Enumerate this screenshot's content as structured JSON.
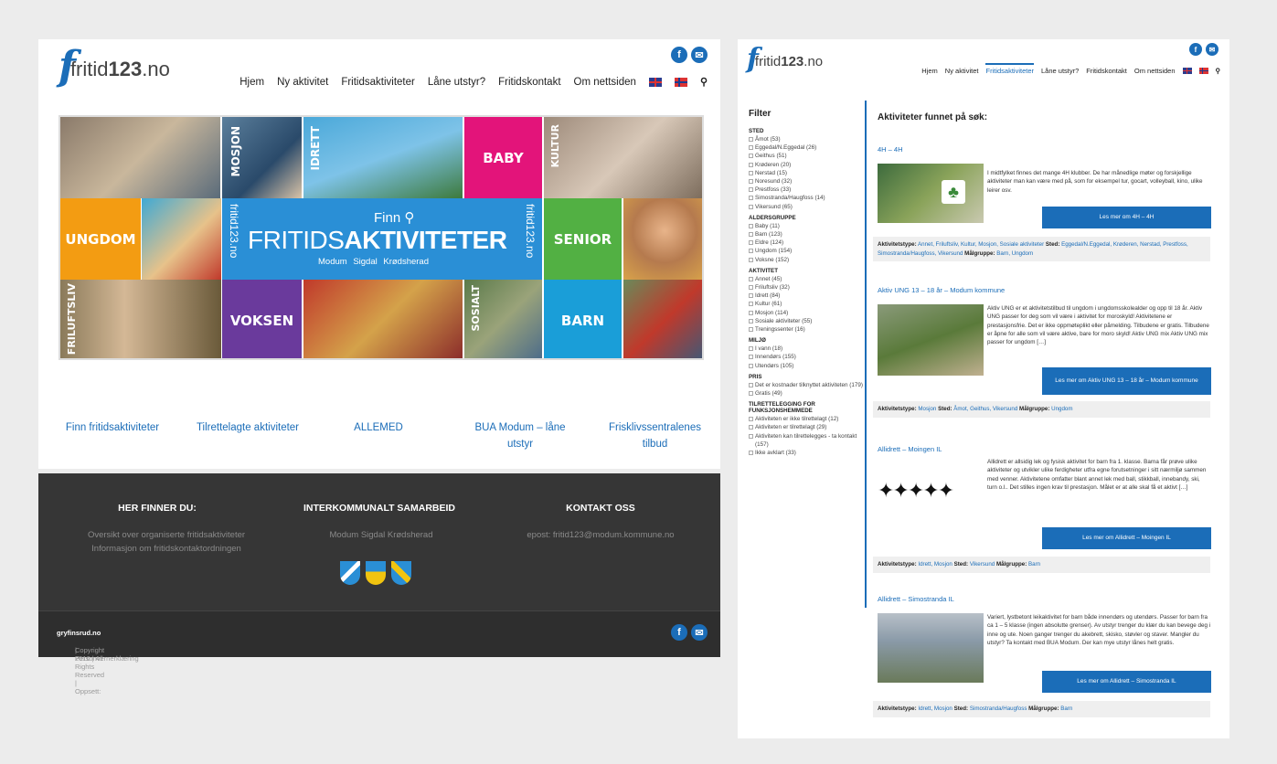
{
  "site": {
    "logo_f": "f",
    "logo_text": "fritid",
    "logo_num": "123",
    "logo_tld": ".no",
    "nav": [
      "Hjem",
      "Ny aktivitet",
      "Fritidsaktiviteter",
      "Låne utstyr?",
      "Fritidskontakt",
      "Om nettsiden"
    ],
    "social": {
      "facebook": "f",
      "email": "✉"
    },
    "search_glyph": "🔍"
  },
  "banner": {
    "tiles": {
      "mosjon": "MOSJON",
      "idrett": "IDRETT",
      "baby": "BABY",
      "kultur": "KULTUR",
      "ungdom": "UNGDOM",
      "senior": "SENIOR",
      "friluftsliv": "FRILUFTSLIV",
      "voksen": "VOKSEN",
      "sosialt": "SOSIALT",
      "barn": "BARN"
    },
    "finn": "Finn",
    "fritids": "FRITIDS",
    "aktiviteter": "AKTIVITETER",
    "places": "Modum  Sigdal  Krødsherad",
    "side_label": "fritid123.no"
  },
  "quicklinks": [
    "Finn fritidsaktiviteter",
    "Tilrettelagte aktiviteter",
    "ALLEMED",
    "BUA Modum – låne utstyr",
    "Frisklivssentralenes tilbud"
  ],
  "footer": {
    "col1_title": "HER FINNER DU:",
    "col1_lines": [
      "Oversikt over organiserte fritidsaktiviteter",
      "Informasjon om fritidskontaktordningen"
    ],
    "col2_title": "INTERKOMMUNALT SAMARBEID",
    "col2_places": "Modum  Sigdal  Krødsherad",
    "col3_title": "KONTAKT OSS",
    "col3_email": "epost: fritid123@modum.kommune.no",
    "copyright": "Copyright 2016 | All Rights Reserved | Oppsett: ",
    "copyright_bold": "gryfinsrud.no",
    "copyright_tail": " | Personvernerklæring"
  },
  "colors": {
    "brand_blue": "#1b6db8",
    "footer_dark": "#363636",
    "baby_pink": "#e3147a",
    "ungdom_orange": "#f39c12",
    "senior_green": "#52b043",
    "voksen_purple": "#6a3a9c",
    "barn_blue": "#1a9ed8"
  },
  "results_page": {
    "filter_title": "Filter",
    "groups": [
      {
        "name": "STED",
        "options": [
          "Åmot (53)",
          "Eggedal/N.Eggedal (26)",
          "Geithus (51)",
          "Krøderen (20)",
          "Nerstad (15)",
          "Noresund (32)",
          "Prestfoss (33)",
          "Simostranda/Haugfoss (14)",
          "Vikersund (65)"
        ]
      },
      {
        "name": "ALDERSGRUPPE",
        "options": [
          "Baby (11)",
          "Barn (123)",
          "Eldre (124)",
          "Ungdom (154)",
          "Voksne (152)"
        ]
      },
      {
        "name": "AKTIVITET",
        "options": [
          "Annet (45)",
          "Friluftsliv (32)",
          "Idrett (84)",
          "Kultur (61)",
          "Mosjon (114)",
          "Sosiale aktiviteter (55)",
          "Treningssenter (16)"
        ]
      },
      {
        "name": "MILJØ",
        "options": [
          "I vann (18)",
          "Innendørs (155)",
          "Utendørs (105)"
        ]
      },
      {
        "name": "PRIS",
        "options": [
          "Det er kostnader tilknyttet aktiviteten (179)",
          "Gratis (49)"
        ]
      },
      {
        "name": "TILRETTELEGGING FOR FUNKSJONSHEMMEDE",
        "options": [
          "Aktiviteten er ikke tilrettelagt (12)",
          "Aktiviteten er tilrettelagt (29)",
          "Aktiviteten kan tilrettelegges - ta kontakt (157)",
          "Ikke avklart (33)"
        ]
      }
    ],
    "heading": "Aktiviteter funnet på søk:",
    "label_type": "Aktivitetstype:",
    "label_sted": "Sted:",
    "label_maal": "Målgruppe:",
    "activities": [
      {
        "title": "4H – 4H",
        "desc": "I midtfylket finnes det mange 4H klubber. De har månedlige møter og forskjellige aktiviteter man kan være med på, som for eksempel tur, gocart, volleyball, kino, ulike leirer osv.",
        "button": "Les mer om 4H – 4H",
        "types": "Annet, Friluftsliv, Kultur, Mosjon, Sosiale aktiviteter",
        "places": "Eggedal/N.Eggedal, Krøderen, Nerstad, Prestfoss, Simostranda/Haugfoss, Vikersund",
        "groups": "Barn, Ungdom"
      },
      {
        "title": "Aktiv UNG 13 – 18 år – Modum kommune",
        "desc": "Aktiv UNG er et aktivitetstilbud til ungdom i ungdomsskolealder og opp til 18 år. Aktiv UNG passer for deg som vil være i aktivitet for moroskyld! Aktivitetene er prestasjonsfrie. Det er ikke oppmøteplikt eller påmelding. Tilbudene er gratis. Tilbudene er åpne for alle som vil være aktive, bare for moro skyld! Aktiv UNG mix Aktiv UNG mix passer for ungdom […]",
        "button": "Les mer om Aktiv UNG 13 – 18 år – Modum kommune",
        "types": "Mosjon",
        "places": "Åmot, Geithus, Vikersund",
        "groups": "Ungdom"
      },
      {
        "title": "Allidrett – Moingen IL",
        "desc": "Allidrett er allsidig lek og fysisk aktivitet for barn fra 1. klasse. Barna får prøve ulike aktiviteter og utvikler ulike ferdigheter utfra egne forutsetninger i sitt nærmiljø sammen med venner. Aktivitetene omfatter blant annet lek med ball, stikkball, innebandy, ski, turn o.l.. Det stilles ingen krav til prestasjon. Målet er at alle skal få et aktivt […]",
        "button": "Les mer om Allidrett – Moingen IL",
        "types": "Idrett, Mosjon",
        "places": "Vikersund",
        "groups": "Barn"
      },
      {
        "title": "Allidrett – Simostranda IL",
        "desc": "Variert, lystbetont leikaktivitet for barn både innendørs og utendørs. Passer for barn fra ca 1 – 5 klasse (ingen absolutte grenser). Av utstyr trenger du klær du kan bevege deg i inne og ute. Noen ganger trenger du akebrett, skisko, støvler og staver. Mangler du utstyr? Ta kontakt med BUA Modum. Der kan mye utstyr lånes helt gratis.",
        "button": "Les mer om Allidrett – Simostranda IL",
        "types": "Idrett, Mosjon",
        "places": "Simostranda/Haugfoss",
        "groups": "Barn"
      }
    ]
  }
}
